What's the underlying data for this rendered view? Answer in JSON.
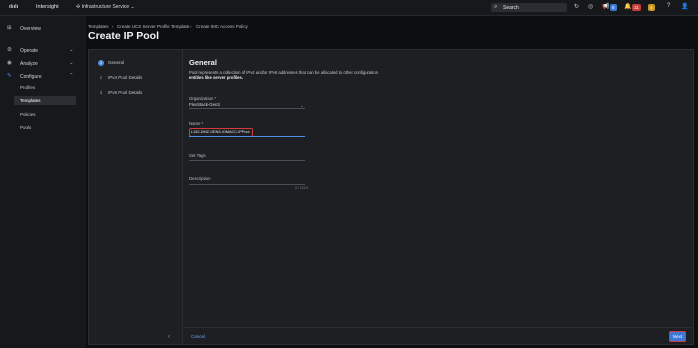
{
  "header": {
    "logo": "ılıılı",
    "brand": "Intersight",
    "service": "Infrastructure Service",
    "search_placeholder": "Search",
    "badges": [
      "8",
      "31",
      "4"
    ]
  },
  "sidebar": {
    "overview": "Overview",
    "operate": "Operate",
    "analyze": "Analyze",
    "configure": "Configure",
    "sub_items": [
      "Profiles",
      "Templates",
      "Policies",
      "Pools"
    ]
  },
  "breadcrumb": [
    "Templates",
    "Create UCS Server Profile Template",
    "Create IMC Access Policy"
  ],
  "page_title": "Create IP Pool",
  "steps": [
    {
      "num": "1",
      "label": "General"
    },
    {
      "num": "2",
      "label": "IPv4 Pool Details"
    },
    {
      "num": "3",
      "label": "IPv6 Pool Details"
    }
  ],
  "form": {
    "heading": "General",
    "description": "Pool represents a collection of IPv4 and/or IPv6 addresses that can be allocated to other configuration",
    "description_bold": "entities like server profiles.",
    "org_label": "Organization *",
    "org_value": "FlexStack-Gen3",
    "name_label": "Name *",
    "name_value": "L152-DMZ-GEN3-IOMACC-IPPool",
    "tags_label": "Set Tags",
    "desc_label": "Description",
    "counter": "0 / 1024"
  },
  "footer": {
    "cancel": "Cancel",
    "next": "Next"
  }
}
